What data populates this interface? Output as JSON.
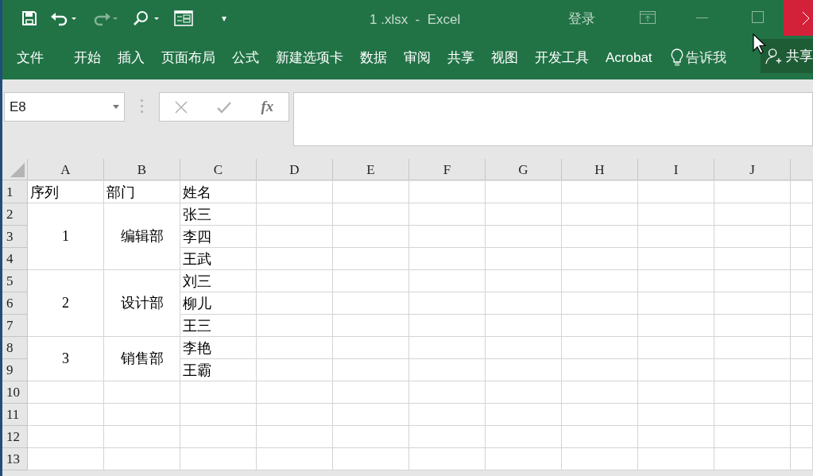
{
  "window": {
    "title": "1 .xlsx  -  Excel",
    "sign_in": "登录"
  },
  "quick_access": {
    "customize": "▾"
  },
  "ribbon_tabs": [
    {
      "label": "文件"
    },
    {
      "label": "开始"
    },
    {
      "label": "插入"
    },
    {
      "label": "页面布局"
    },
    {
      "label": "公式"
    },
    {
      "label": "新建选项卡"
    },
    {
      "label": "数据"
    },
    {
      "label": "审阅"
    },
    {
      "label": "共享"
    },
    {
      "label": "视图"
    },
    {
      "label": "开发工具"
    },
    {
      "label": "Acrobat"
    }
  ],
  "tell_me": "告诉我",
  "share": "共享",
  "formula_bar": {
    "name_box": "E8",
    "fx": "fx"
  },
  "sheet": {
    "columns": [
      "A",
      "B",
      "C",
      "D",
      "E",
      "F",
      "G",
      "H",
      "I",
      "J"
    ],
    "row_numbers": [
      "1",
      "2",
      "3",
      "4",
      "5",
      "6",
      "7",
      "8",
      "9",
      "10",
      "11",
      "12",
      "13"
    ],
    "header": [
      "序列",
      "部门",
      "姓名"
    ],
    "groups": [
      {
        "seq": "1",
        "dept": "编辑部",
        "names": [
          "张三",
          "李四",
          "王武"
        ]
      },
      {
        "seq": "2",
        "dept": "设计部",
        "names": [
          "刘三",
          "柳儿",
          "王三"
        ]
      },
      {
        "seq": "3",
        "dept": "销售部",
        "names": [
          "李艳",
          "王霸"
        ]
      }
    ]
  }
}
